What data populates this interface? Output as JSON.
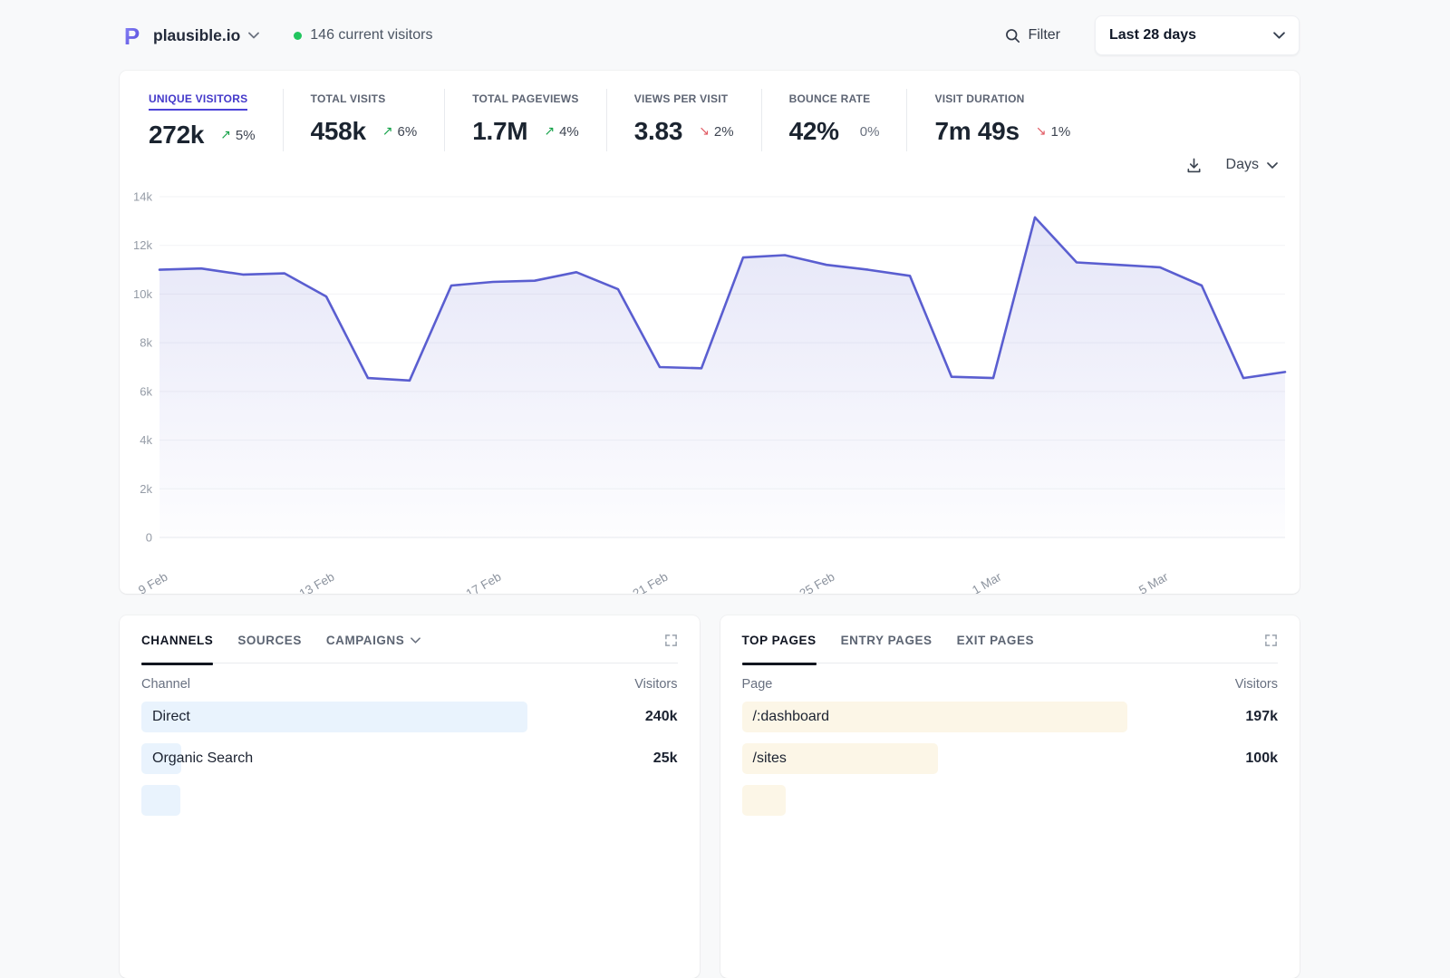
{
  "header": {
    "site": "plausible.io",
    "current_visitors": "146 current visitors",
    "filter_label": "Filter",
    "date_range": "Last 28 days"
  },
  "stats": [
    {
      "label": "UNIQUE VISITORS",
      "value": "272k",
      "arrow": "↗",
      "change": "5%",
      "trend": "up"
    },
    {
      "label": "TOTAL VISITS",
      "value": "458k",
      "arrow": "↗",
      "change": "6%",
      "trend": "up"
    },
    {
      "label": "TOTAL PAGEVIEWS",
      "value": "1.7M",
      "arrow": "↗",
      "change": "4%",
      "trend": "up"
    },
    {
      "label": "VIEWS PER VISIT",
      "value": "3.83",
      "arrow": "↘",
      "change": "2%",
      "trend": "down"
    },
    {
      "label": "BOUNCE RATE",
      "value": "42%",
      "arrow": "",
      "change": "0%",
      "trend": "flat"
    },
    {
      "label": "VISIT DURATION",
      "value": "7m 49s",
      "arrow": "↘",
      "change": "1%",
      "trend": "down"
    }
  ],
  "toolbar": {
    "interval": "Days"
  },
  "chart_data": {
    "type": "area",
    "title": "Unique visitors over last 28 days",
    "x": [
      "9 Feb",
      "10 Feb",
      "11 Feb",
      "12 Feb",
      "13 Feb",
      "14 Feb",
      "15 Feb",
      "16 Feb",
      "17 Feb",
      "18 Feb",
      "19 Feb",
      "20 Feb",
      "21 Feb",
      "22 Feb",
      "23 Feb",
      "24 Feb",
      "25 Feb",
      "26 Feb",
      "27 Feb",
      "28 Feb",
      "1 Mar",
      "2 Mar",
      "3 Mar",
      "4 Mar",
      "5 Mar",
      "6 Mar",
      "7 Mar",
      "8 Mar"
    ],
    "values": [
      11000,
      11050,
      10800,
      10850,
      9900,
      6550,
      6450,
      10350,
      10500,
      10550,
      10900,
      10200,
      7000,
      6950,
      11500,
      11600,
      11200,
      11000,
      10750,
      6600,
      6550,
      13150,
      11300,
      11200,
      11100,
      10350,
      6550,
      6800
    ],
    "ylim": [
      0,
      14000
    ],
    "y_ticks": [
      0,
      2000,
      4000,
      6000,
      8000,
      10000,
      12000,
      14000
    ],
    "y_tick_labels": [
      "0",
      "2k",
      "4k",
      "6k",
      "8k",
      "10k",
      "12k",
      "14k"
    ],
    "x_tick_indices": [
      0,
      4,
      8,
      12,
      16,
      20,
      24
    ],
    "grid": true,
    "legend": "none",
    "line_color": "#5a5ed0",
    "fill_top": "rgba(93,97,208,0.16)",
    "fill_bottom": "rgba(93,97,208,0.01)"
  },
  "channels_panel": {
    "tabs": [
      "CHANNELS",
      "SOURCES",
      "CAMPAIGNS"
    ],
    "active_tab": "CHANNELS",
    "columns": {
      "label": "Channel",
      "value": "Visitors"
    },
    "bar_color": "#e9f3fd",
    "rows": [
      {
        "label": "Direct",
        "value": "240k",
        "bar_fraction": 1
      },
      {
        "label": "Organic Search",
        "value": "25k",
        "bar_fraction": 0.104
      },
      {
        "label": "",
        "value": "",
        "bar_fraction": 0.1
      }
    ]
  },
  "pages_panel": {
    "tabs": [
      "TOP PAGES",
      "ENTRY PAGES",
      "EXIT PAGES"
    ],
    "active_tab": "TOP PAGES",
    "columns": {
      "label": "Page",
      "value": "Visitors"
    },
    "bar_color": "#fcf6e7",
    "rows": [
      {
        "label": "/:dashboard",
        "value": "197k",
        "bar_fraction": 1
      },
      {
        "label": "/sites",
        "value": "100k",
        "bar_fraction": 0.508
      },
      {
        "label": "",
        "value": "",
        "bar_fraction": 0.115
      }
    ]
  },
  "colors": {
    "accent_indigo": "#4338ca",
    "chart_line": "#5a5ed0",
    "positive_green": "#16a34a",
    "negative_red": "#e15b64",
    "live_dot_green": "#22c55e"
  }
}
